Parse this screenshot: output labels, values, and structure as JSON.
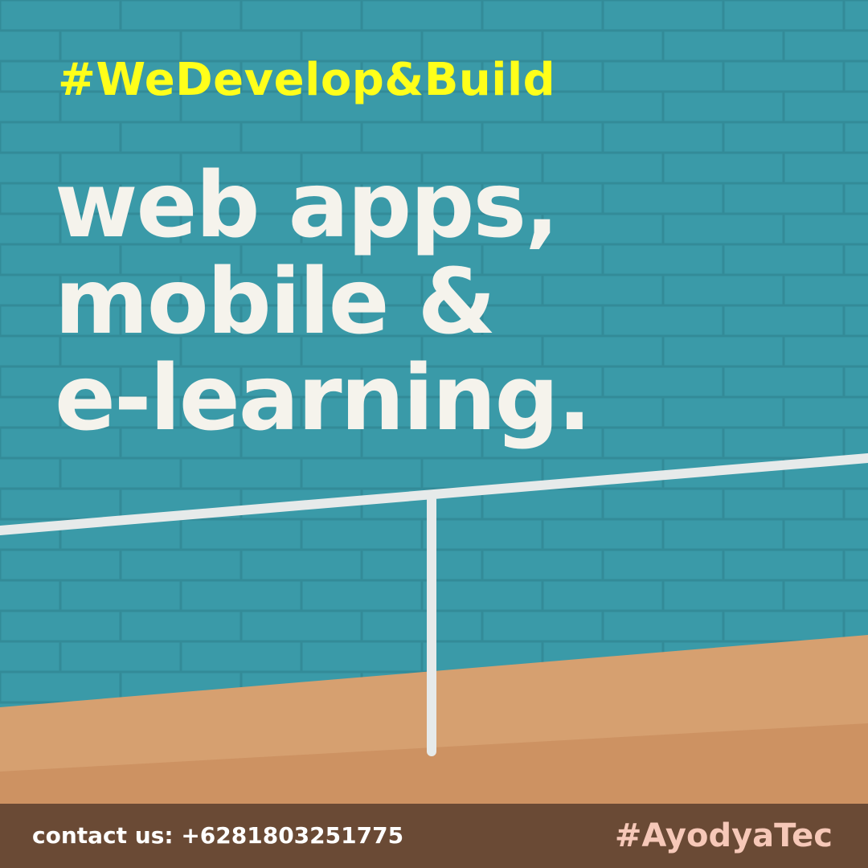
{
  "post": {
    "hashtag_top": "#WeDevelop&Build",
    "headline_lines": [
      "web apps,",
      "mobile &",
      "e-learning."
    ],
    "contact": "contact us: +6281803251775",
    "brand_hashtag": "#AyodyaTec"
  },
  "colors": {
    "wall": "#3a9aa8",
    "mortar": "#2f7f8c",
    "hashtag_top": "#ffff1a",
    "headline": "#f5f3ec",
    "floor": "#d6a070",
    "footer_bar": "#6a4a35",
    "brand_hashtag": "#f6c8b8",
    "railing": "#e6eaea"
  }
}
